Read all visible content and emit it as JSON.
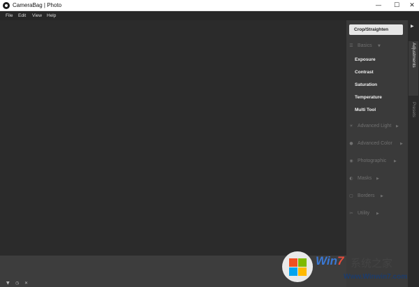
{
  "window": {
    "title": "CameraBag | Photo",
    "minimize_glyph": "—",
    "maximize_glyph": "☐",
    "close_glyph": "✕"
  },
  "menu": [
    "File",
    "Edit",
    "View",
    "Help"
  ],
  "panel": {
    "crop_button": "Crop/Straighten",
    "basics": {
      "label": "Basics",
      "icon": "sliders-icon",
      "items": [
        "Exposure",
        "Contrast",
        "Saturation",
        "Temperature",
        "Multi Tool"
      ]
    },
    "sections": [
      {
        "label": "Advanced Light",
        "icon": "sun-icon"
      },
      {
        "label": "Advanced Color",
        "icon": "palette-icon"
      },
      {
        "label": "Photographic",
        "icon": "camera-icon"
      },
      {
        "label": "Masks",
        "icon": "mask-icon"
      },
      {
        "label": "Borders",
        "icon": "border-icon"
      },
      {
        "label": "Utility",
        "icon": "tools-icon"
      }
    ],
    "arrow_glyph": "▶",
    "expanded_glyph": "▼"
  },
  "tabs": {
    "collapse_glyph": "▶",
    "adjustments": "Adjustments",
    "presets": "Presets"
  },
  "bottom_controls": {
    "filter_glyph": "▼",
    "clock_glyph": "◷",
    "close_glyph": "✕"
  },
  "watermark": {
    "brand_prefix": "Win",
    "brand_number": "7",
    "brand_suffix": "系统之家",
    "url": "Www.Winwin7.com"
  },
  "colors": {
    "canvas_bg": "#2b2b2b",
    "panel_bg": "#3a3a3a",
    "filmstrip_bg": "#3d3d3d",
    "titlebar_bg": "#ffffff",
    "menubar_bg": "#262626",
    "dim_text": "#707070",
    "bright_text": "#f2f2f2"
  }
}
